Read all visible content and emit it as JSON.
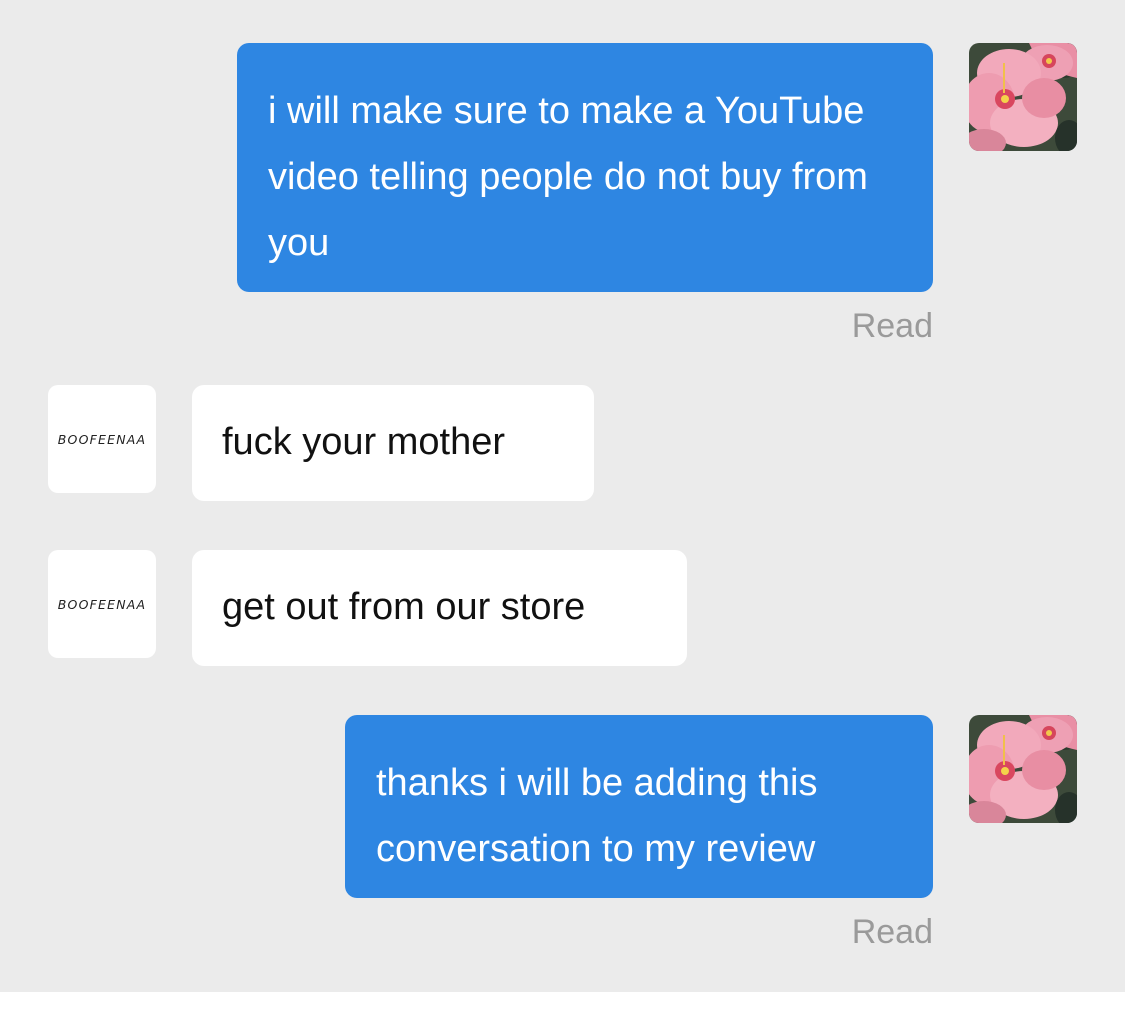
{
  "conversation": {
    "messages": [
      {
        "sender": "me",
        "text": "i will make sure to make a YouTube video telling people do not buy from you",
        "receipt": "Read"
      },
      {
        "sender": "store",
        "text": "fuck your mother"
      },
      {
        "sender": "store",
        "text": "get out from our store"
      },
      {
        "sender": "me",
        "text": "thanks i will be adding this conversation to my review",
        "receipt": "Read"
      }
    ]
  },
  "store": {
    "logo_text": "BOOFEENAA"
  },
  "user": {
    "avatar_icon": "pink-hibiscus-flower-avatar"
  },
  "colors": {
    "background": "#ebebeb",
    "outgoing_bubble": "#2e86e2",
    "incoming_bubble": "#ffffff",
    "receipt_text": "#9a9a9a"
  }
}
